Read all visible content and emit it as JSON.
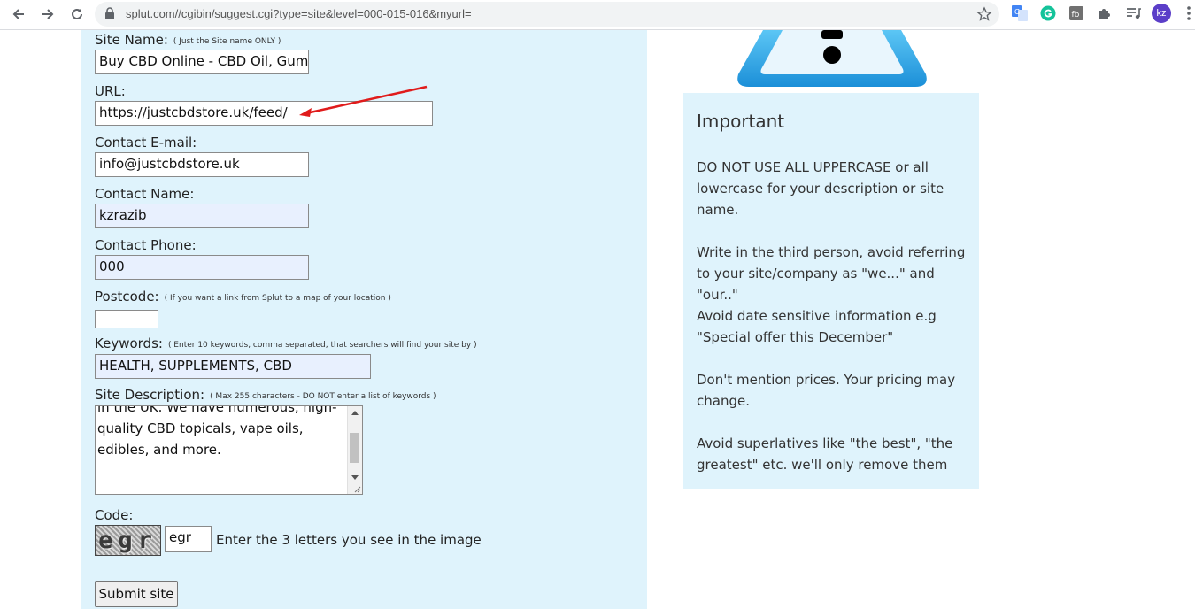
{
  "browser": {
    "url": "splut.com//cgibin/suggest.cgi?type=site&level=000-015-016&myurl=",
    "profile_initials": "kz"
  },
  "form": {
    "site_name": {
      "label": "Site Name:",
      "hint": "( Just the Site name ONLY )",
      "value": "Buy CBD Online - CBD Oil, Gumm"
    },
    "url": {
      "label": "URL:",
      "value": "https://justcbdstore.uk/feed/"
    },
    "email": {
      "label": "Contact E-mail:",
      "value": "info@justcbdstore.uk"
    },
    "contact_name": {
      "label": "Contact Name:",
      "value": "kzrazib"
    },
    "contact_phone": {
      "label": "Contact Phone:",
      "value": "000"
    },
    "postcode": {
      "label": "Postcode:",
      "hint": "( If you want a link from Splut to a map of your location )",
      "value": ""
    },
    "keywords": {
      "label": "Keywords:",
      "hint": "( Enter 10 keywords, comma separated, that searchers will find your site by )",
      "value": "HEALTH, SUPPLEMENTS, CBD"
    },
    "description": {
      "label": "Site Description:",
      "hint": "( Max 255 characters - DO NOT enter a list of keywords )",
      "value": "in the UK. We have numerous, high-quality CBD topicals, vape oils, edibles, and more."
    },
    "code": {
      "label": "Code:",
      "captcha_text": "egr",
      "value": "egr",
      "instruction": "Enter the 3 letters you see in the image"
    },
    "submit_label": "Submit site"
  },
  "important": {
    "title": "Important",
    "paragraphs": [
      "DO NOT USE ALL UPPERCASE or all lowercase for your description or site name.",
      "Write in the third person, avoid referring to your site/company as \"we...\" and \"our..\"",
      "Avoid date sensitive information e.g \"Special offer this December\"",
      "Don't mention prices. Your pricing may change.",
      "Avoid superlatives like \"the best\", \"the greatest\" etc. we'll only remove them"
    ]
  },
  "colors": {
    "panel_bg": "#dff3fc",
    "annotation_arrow": "#e01b1b",
    "warning_sign": "#1d9be0"
  }
}
